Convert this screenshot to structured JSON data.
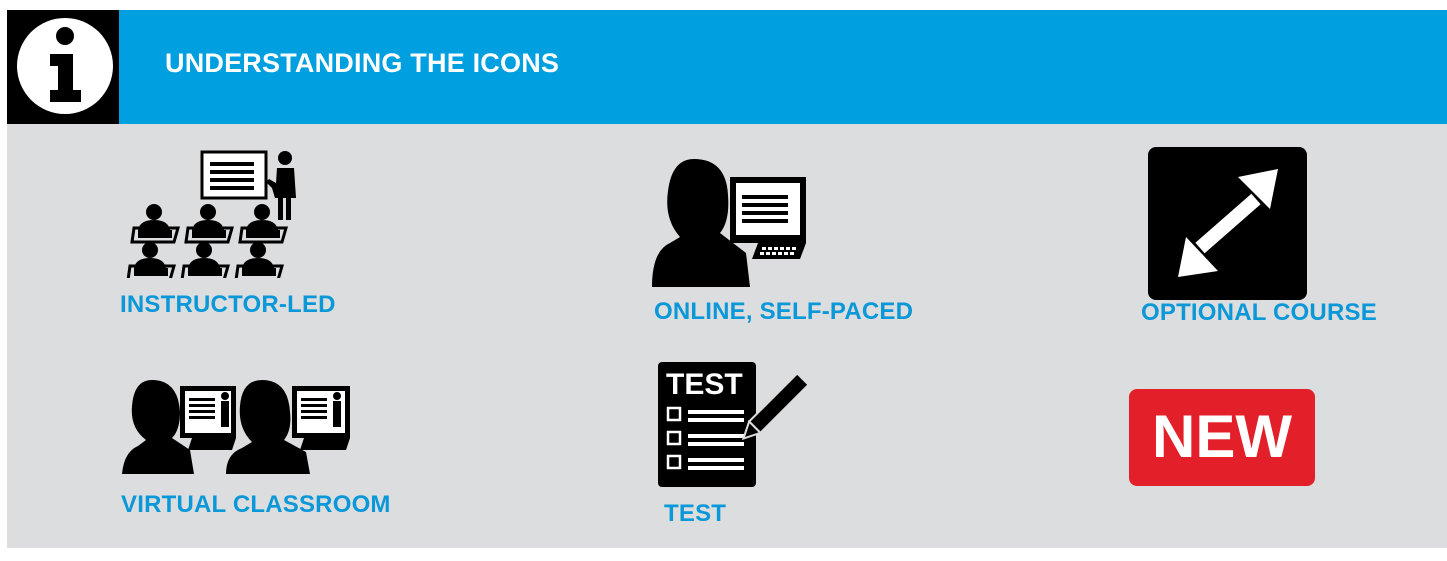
{
  "header": {
    "title": "UNDERSTANDING THE ICONS",
    "icon": "info-icon",
    "background_color": "#009fdf"
  },
  "legend": {
    "items": [
      {
        "label": "INSTRUCTOR-LED",
        "icon": "instructor-led-icon"
      },
      {
        "label": "ONLINE, SELF-PACED",
        "icon": "online-self-paced-icon"
      },
      {
        "label": "OPTIONAL COURSE",
        "icon": "optional-course-icon"
      },
      {
        "label": "VIRTUAL CLASSROOM",
        "icon": "virtual-classroom-icon"
      },
      {
        "label": "TEST",
        "icon": "test-icon",
        "icon_text": "TEST"
      },
      {
        "label": "",
        "icon": "new-badge-icon",
        "icon_text": "NEW"
      }
    ],
    "label_color": "#0a98d8",
    "new_badge_color": "#e3202a"
  }
}
